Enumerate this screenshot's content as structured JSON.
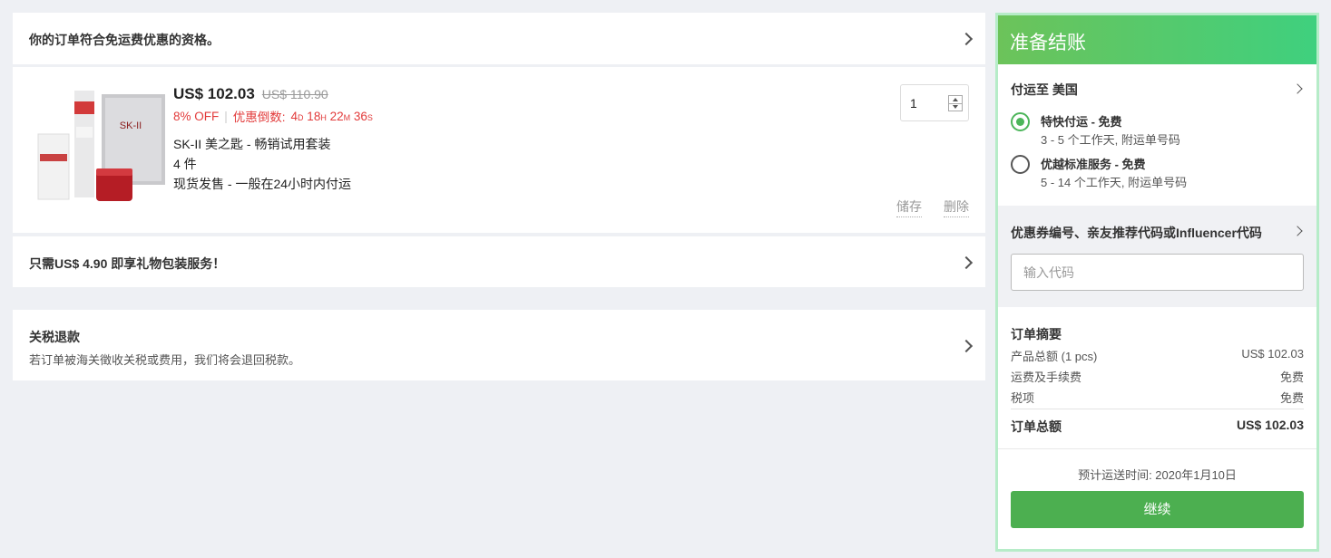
{
  "free_shipping": {
    "text": "你的订单符合免运费优惠的资格。"
  },
  "item": {
    "price_now": "US$ 102.03",
    "price_old": "US$ 110.90",
    "discount": "8% OFF",
    "countdown_label": "优惠倒数:",
    "countdown_value": "4d 18h 22m 36s",
    "name": "SK-II 美之匙 - 畅销试用套装",
    "count": "4 件",
    "stock": "现货发售 - 一般在24小时内付运",
    "quantity": "1",
    "save_label": "储存",
    "delete_label": "删除",
    "image_label": "SK-II"
  },
  "gift": {
    "text": "只需US$ 4.90 即享礼物包装服务！"
  },
  "refund": {
    "title": "关税退款",
    "desc": "若订单被海关徵收关税或费用，我们将会退回税款。"
  },
  "checkout": {
    "title": "准备结账",
    "ship_to": "付运至 美国",
    "options": [
      {
        "name": "特快付运 - 免费",
        "sub": "3 - 5 个工作天, 附运单号码",
        "selected": true
      },
      {
        "name": "优越标准服务 - 免费",
        "sub": "5 - 14 个工作天, 附运单号码",
        "selected": false
      }
    ],
    "coupon_label": "优惠券编号、亲友推荐代码或Influencer代码",
    "coupon_placeholder": "输入代码",
    "summary": {
      "title": "订单摘要",
      "rows": [
        {
          "label": "产品总额 (1 pcs)",
          "value": "US$ 102.03"
        },
        {
          "label": "运费及手续费",
          "value": "免费"
        },
        {
          "label": "税项",
          "value": "免费"
        }
      ],
      "total_label": "订单总额",
      "total_value": "US$ 102.03"
    },
    "eta": "预计运送时间: 2020年1月10日",
    "continue_label": "继续"
  },
  "colors": {
    "accent_green": "#4caf50",
    "promo_red": "#e23b3b",
    "header_gradient_start": "#6cc35a",
    "header_gradient_end": "#3fd07e"
  }
}
